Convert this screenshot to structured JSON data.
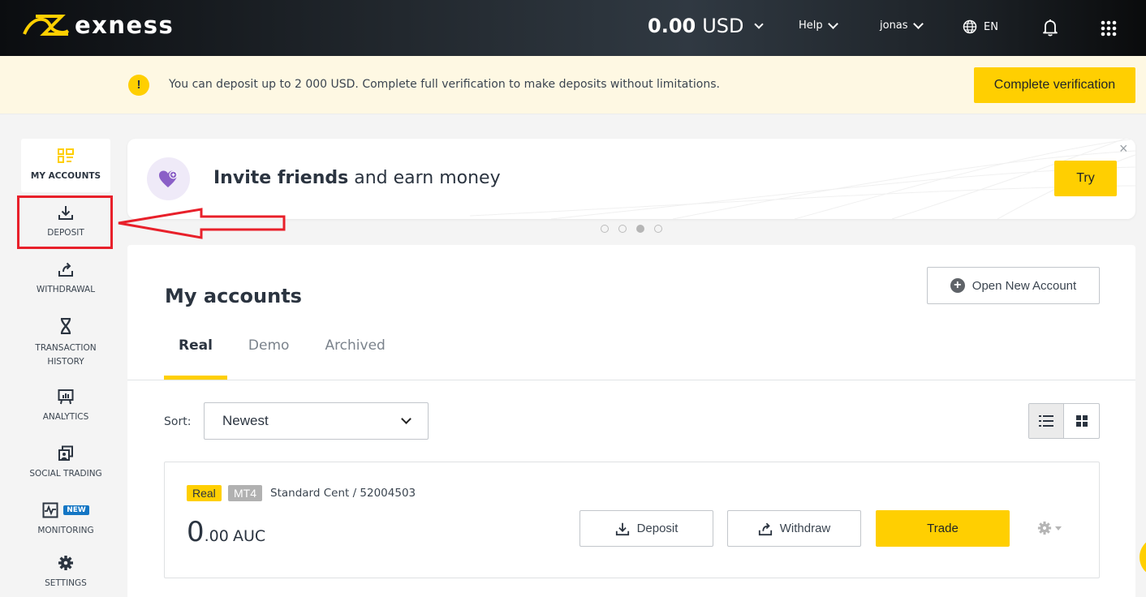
{
  "header": {
    "brand": "exness",
    "balance_amount": "0.00",
    "balance_currency": "USD",
    "help_label": "Help",
    "user_label": "jonas",
    "language_label": "EN",
    "icons": {
      "logo": "exness-logo-icon",
      "language": "globe-icon",
      "notifications": "bell-icon",
      "apps": "apps-grid-icon"
    }
  },
  "notice": {
    "icon": "!",
    "text": "You can deposit up to 2 000 USD. Complete full verification to make deposits without limitations.",
    "button_label": "Complete verification"
  },
  "sidebar": {
    "items": [
      {
        "label": "MY ACCOUNTS",
        "icon": "accounts-icon",
        "active": true
      },
      {
        "label": "DEPOSIT",
        "icon": "deposit-icon",
        "highlighted": true
      },
      {
        "label": "WITHDRAWAL",
        "icon": "withdrawal-icon"
      },
      {
        "label": "TRANSACTION HISTORY",
        "icon": "hourglass-icon"
      },
      {
        "label": "ANALYTICS",
        "icon": "analytics-icon"
      },
      {
        "label": "SOCIAL TRADING",
        "icon": "social-trading-icon"
      },
      {
        "label": "MONITORING",
        "icon": "monitoring-icon",
        "badge": "NEW"
      },
      {
        "label": "SETTINGS",
        "icon": "gear-icon"
      }
    ]
  },
  "promo": {
    "title_bold": "Invite friends",
    "title_rest": " and earn money",
    "button_label": "Try",
    "close_label": "×",
    "slides_total": 4,
    "active_slide": 3
  },
  "main": {
    "title": "My accounts",
    "open_account_label": "Open New Account",
    "tabs": [
      {
        "label": "Real",
        "active": true
      },
      {
        "label": "Demo"
      },
      {
        "label": "Archived"
      }
    ],
    "sort_label": "Sort:",
    "sort_value": "Newest",
    "view_modes": [
      "list",
      "grid"
    ],
    "active_view": "list"
  },
  "account": {
    "type_tag": "Real",
    "platform_tag": "MT4",
    "name": "Standard Cent / 52004503",
    "balance_int": "0",
    "balance_dec": ".00",
    "currency": "AUC",
    "deposit_label": "Deposit",
    "withdraw_label": "Withdraw",
    "trade_label": "Trade"
  },
  "colors": {
    "accent": "#ffcf01",
    "header_dark": "#22282e",
    "highlight_red": "#e8202a",
    "new_badge": "#1476c4"
  }
}
